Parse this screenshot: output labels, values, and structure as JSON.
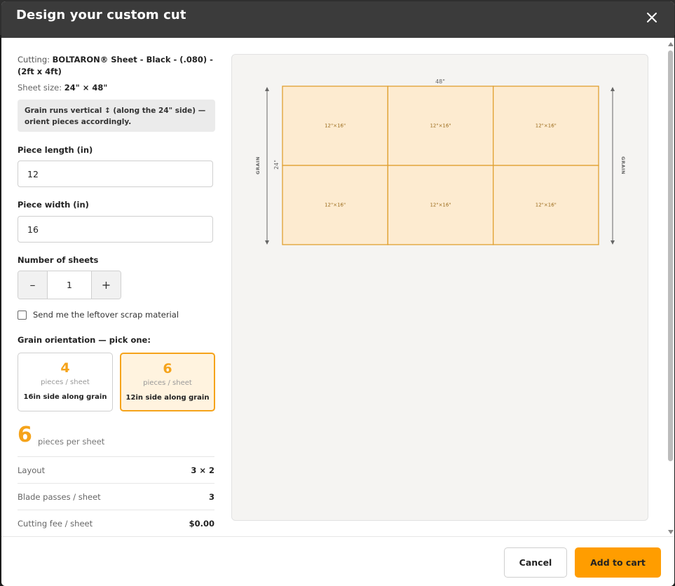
{
  "modal": {
    "title": "Design your custom cut"
  },
  "product": {
    "cutting_label": "Cutting:",
    "cutting_value": "BOLTARON® Sheet - Black - (.080) - (2ft x 4ft)",
    "sheet_size_label": "Sheet size:",
    "sheet_size_value": "24\" × 48\"",
    "grain_note": "Grain runs vertical ↕ (along the 24\" side) — orient pieces accordingly."
  },
  "form": {
    "piece_length_label": "Piece length (in)",
    "piece_length_value": "12",
    "piece_width_label": "Piece width (in)",
    "piece_width_value": "16",
    "num_sheets_label": "Number of sheets",
    "num_sheets_value": "1",
    "minus_label": "–",
    "plus_label": "+",
    "scrap_label": "Send me the leftover scrap material",
    "scrap_checked": false
  },
  "orientation": {
    "title": "Grain orientation — pick one:",
    "options": [
      {
        "count": "4",
        "unit": "pieces / sheet",
        "desc": "16in side along grain",
        "selected": false
      },
      {
        "count": "6",
        "unit": "pieces / sheet",
        "desc": "12in side along grain",
        "selected": true
      }
    ]
  },
  "summary": {
    "count": "6",
    "count_label": "pieces per sheet",
    "rows": [
      {
        "label": "Layout",
        "value": "3 × 2"
      },
      {
        "label": "Blade passes / sheet",
        "value": "3"
      },
      {
        "label": "Cutting fee / sheet",
        "value": "$0.00"
      }
    ]
  },
  "diagram": {
    "width_label": "48\"",
    "height_label": "24\"",
    "grain_label_left": "GRAIN",
    "grain_label_right": "GRAIN",
    "cols": 3,
    "rows": 2,
    "piece_label": "12\"×16\"",
    "fill_color": "#fdebd0",
    "stroke_color": "#e0a030"
  },
  "footer": {
    "cancel_label": "Cancel",
    "add_label": "Add to cart"
  },
  "colors": {
    "accent": "#ff9d00",
    "header_bg": "#3b3b3b"
  }
}
